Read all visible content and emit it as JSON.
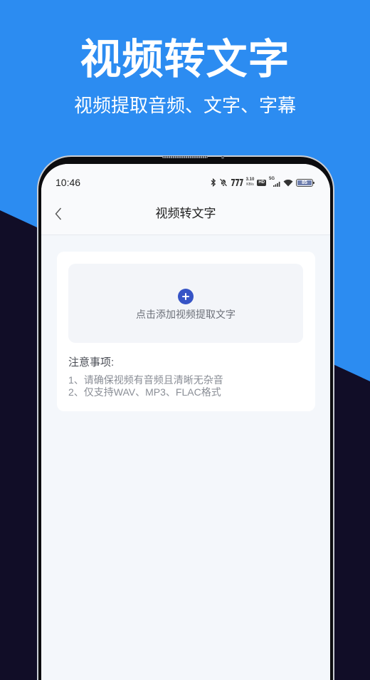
{
  "banner": {
    "title": "视频转文字",
    "subtitle": "视频提取音频、文字、字幕"
  },
  "status_bar": {
    "time": "10:46",
    "net_speed": "3.10",
    "net_speed_unit": "KB/s",
    "hd_label": "HD",
    "network_type": "5G",
    "battery_level": "85",
    "icons": [
      "bluetooth-icon",
      "mute-icon",
      "signal-icon",
      "hd-icon",
      "mobile-signal-icon",
      "wifi-icon",
      "battery-icon"
    ]
  },
  "nav": {
    "back_icon": "chevron-left-icon",
    "title": "视频转文字"
  },
  "upload": {
    "icon": "plus-circle-icon",
    "label": "点击添加视频提取文字"
  },
  "notes": {
    "heading": "注意事项:",
    "items": [
      "1、请确保视频有音频且清晰无杂音",
      "2、仅支持WAV、MP3、FLAC格式"
    ]
  },
  "colors": {
    "banner_blue": "#2c8cf1",
    "dark_navy": "#110d27",
    "accent": "#3654c6",
    "screen_bg": "#f4f7fb"
  }
}
